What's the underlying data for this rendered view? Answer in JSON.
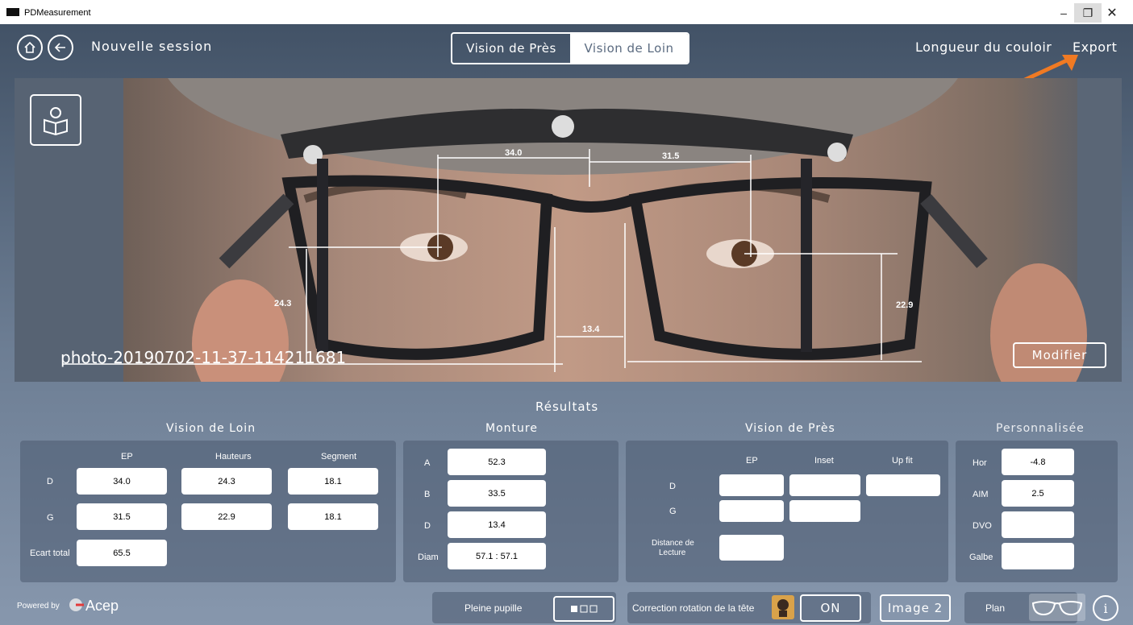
{
  "window": {
    "title": "PDMeasurement"
  },
  "header": {
    "home_icon": "home-icon",
    "back_icon": "back-arrow-icon",
    "session": "Nouvelle session",
    "tabs": [
      {
        "label": "Vision de Près",
        "active": false
      },
      {
        "label": "Vision de Loin",
        "active": true
      }
    ],
    "couloir": "Longueur du couloir",
    "export": "Export"
  },
  "photo": {
    "filename": "photo-20190702-11-37-114211681",
    "modifier": "Modifier",
    "measures": {
      "left_ep": "34.0",
      "right_ep": "31.5",
      "left_height": "24.3",
      "right_height": "22.9",
      "bridge": "13.4"
    }
  },
  "results": {
    "title": "Résultats",
    "vision_loin": {
      "title": "Vision de Loin",
      "headers": [
        "EP",
        "Hauteurs",
        "Segment"
      ],
      "rows": [
        {
          "label": "D",
          "values": [
            "34.0",
            "24.3",
            "18.1"
          ]
        },
        {
          "label": "G",
          "values": [
            "31.5",
            "22.9",
            "18.1"
          ]
        }
      ],
      "total_label": "Ecart total",
      "total_value": "65.5"
    },
    "monture": {
      "title": "Monture",
      "rows": [
        {
          "label": "A",
          "value": "52.3"
        },
        {
          "label": "B",
          "value": "33.5"
        },
        {
          "label": "D",
          "value": "13.4"
        },
        {
          "label": "Diam",
          "value": "57.1 : 57.1"
        }
      ]
    },
    "vision_pres": {
      "title": "Vision de Près",
      "headers": [
        "EP",
        "Inset",
        "Up fit"
      ],
      "row_d": "D",
      "row_g": "G",
      "distance_label_1": "Distance de",
      "distance_label_2": "Lecture"
    },
    "perso": {
      "title": "Personnalisée",
      "rows": [
        {
          "label": "Hor",
          "value": "-4.8"
        },
        {
          "label": "AIM",
          "value": "2.5"
        },
        {
          "label": "DVO",
          "value": ""
        },
        {
          "label": "Galbe",
          "value": ""
        }
      ]
    }
  },
  "footer": {
    "powered": "Powered by",
    "brand": "Acep",
    "pleine": "Pleine pupille",
    "correction": "Correction rotation de la tête",
    "on": "ON",
    "image2": "Image 2",
    "plan": "Plan"
  },
  "colors": {
    "accent_arrow": "#f07a23",
    "field": "#ffffff"
  }
}
